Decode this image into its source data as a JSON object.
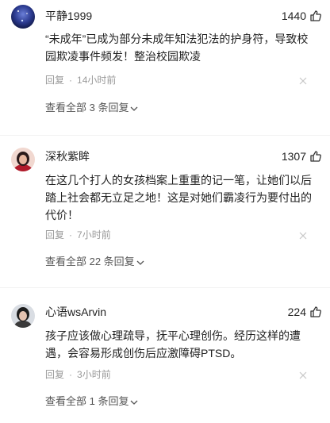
{
  "comments": [
    {
      "username": "平静1999",
      "likes": "1440",
      "content": "“未成年”已成为部分未成年知法犯法的护身符，导致校园欺凌事件频发！整治校园欺凌",
      "reply_label": "回复",
      "time": "14小时前",
      "view_replies": "查看全部 3 条回复",
      "avatar_icon": "blue-night-sky-avatar"
    },
    {
      "username": "深秋紫眸",
      "likes": "1307",
      "content": "在这几个打人的女孩档案上重重的记一笔，让她们以后踏上社会都无立足之地！这是对她们霸凌行为要付出的代价！",
      "reply_label": "回复",
      "time": "7小时前",
      "view_replies": "查看全部 22 条回复",
      "avatar_icon": "red-portrait-avatar"
    },
    {
      "username": "心语wsArvin",
      "likes": "224",
      "content": "孩子应该做心理疏导，抚平心理创伤。经历这样的遭遇，会容易形成创伤后应激障碍PTSD。",
      "reply_label": "回复",
      "time": "3小时前",
      "view_replies": "查看全部 1 条回复",
      "avatar_icon": "dark-portrait-avatar"
    }
  ],
  "separator": "·",
  "icons": {
    "like": "thumbs-up-icon",
    "close": "close-icon",
    "expand": "chevron-down-icon"
  }
}
